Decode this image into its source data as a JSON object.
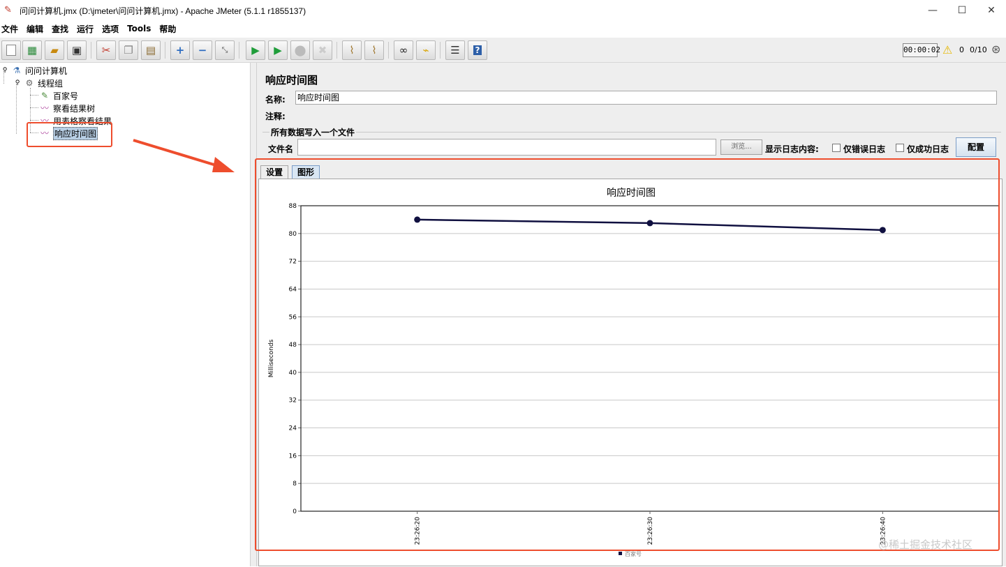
{
  "window": {
    "title": "问问计算机.jmx (D:\\jmeter\\问问计算机.jmx) - Apache JMeter (5.1.1 r1855137)",
    "minimize": "—",
    "maximize": "☐",
    "close": "✕"
  },
  "menu": {
    "items": [
      "文件",
      "编辑",
      "查找",
      "运行",
      "选项",
      "Tools",
      "帮助"
    ]
  },
  "toolbar": {
    "icons": [
      "new-icon",
      "templates-icon",
      "open-icon",
      "save-icon",
      "cut-icon",
      "copy-icon",
      "paste-icon",
      "expand-icon",
      "collapse-icon",
      "toggle-icon",
      "start-icon",
      "start-no-pause-icon",
      "stop-icon",
      "shutdown-icon",
      "clear-icon",
      "clear-all-icon",
      "search-icon",
      "reset-search-icon",
      "function-helper-icon",
      "help-icon"
    ],
    "elapsed": "00:00:02",
    "warnings": "0",
    "threads": "0/10"
  },
  "tree": {
    "items": [
      {
        "label": "问问计算机",
        "icon": "test-plan-icon"
      },
      {
        "label": "线程组",
        "icon": "thread-group-icon"
      },
      {
        "label": "百家号",
        "icon": "sampler-icon"
      },
      {
        "label": "察看结果树",
        "icon": "listener-icon"
      },
      {
        "label": "用表格察看结果",
        "icon": "listener-icon"
      },
      {
        "label": "响应时间图",
        "icon": "listener-icon"
      }
    ],
    "selected_index": 5
  },
  "panel": {
    "title": "响应时间图",
    "name_label": "名称:",
    "name_value": "响应时间图",
    "comment_label": "注释:",
    "file_section": "所有数据写入一个文件",
    "file_label": "文件名",
    "file_value": "",
    "browse_button": "浏览...",
    "log_label": "显示日志内容:",
    "errors_only": "仅错误日志",
    "errors_only_checked": false,
    "success_only": "仅成功日志",
    "success_only_checked": false,
    "config_button": "配置",
    "tabs": [
      "设置",
      "图形"
    ],
    "active_tab": 1
  },
  "chart_data": {
    "type": "line",
    "title": "响应时间图",
    "xlabel": "",
    "ylabel": "Milliseconds",
    "x": [
      "23:26:20",
      "23:26:30",
      "23:26:40"
    ],
    "series": [
      {
        "name": "百家号",
        "values": [
          84,
          83,
          81
        ],
        "color": "#101040"
      }
    ],
    "ylim": [
      0,
      88
    ],
    "yticks": [
      0,
      8,
      16,
      24,
      32,
      40,
      48,
      56,
      64,
      72,
      80,
      88
    ],
    "grid": true,
    "legend": "bottom"
  },
  "watermark": "@稀土掘金技术社区",
  "colors": {
    "highlight": "#ee4d2d",
    "selection": "#b8cfe5",
    "line": "#101040"
  }
}
